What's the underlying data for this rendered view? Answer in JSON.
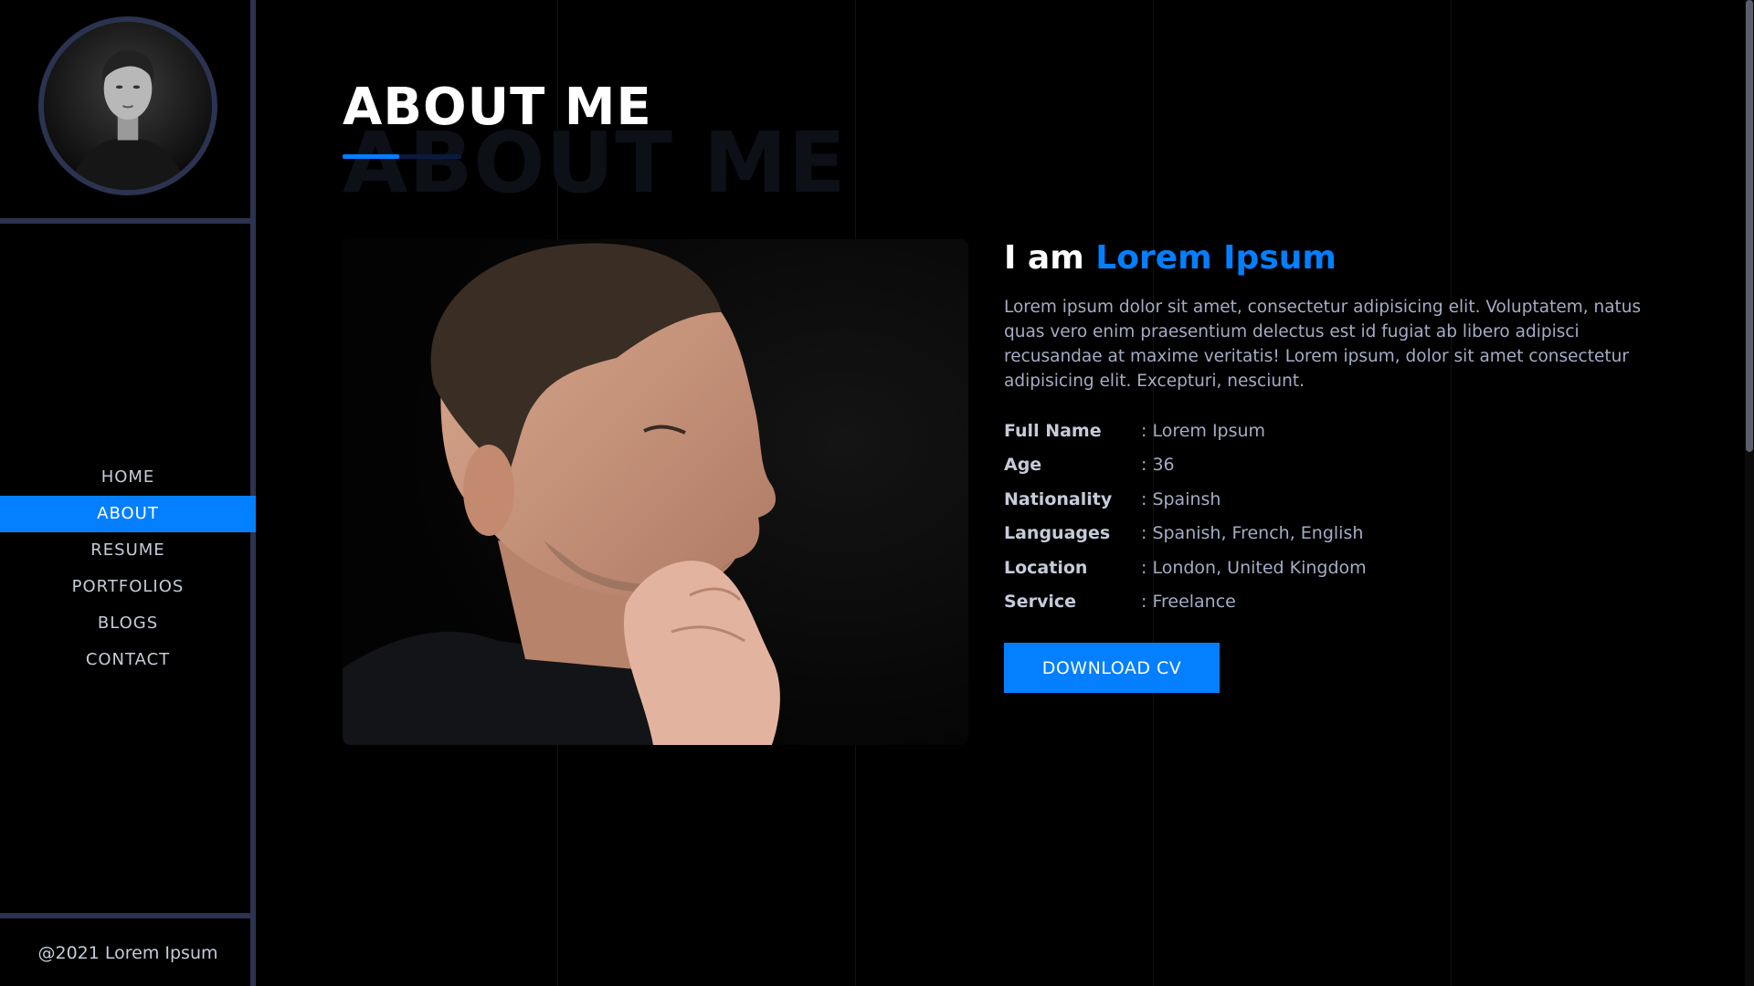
{
  "sidebar": {
    "nav": [
      {
        "label": "HOME",
        "active": false
      },
      {
        "label": "ABOUT",
        "active": true
      },
      {
        "label": "RESUME",
        "active": false
      },
      {
        "label": "PORTFOLIOS",
        "active": false
      },
      {
        "label": "BLOGS",
        "active": false
      },
      {
        "label": "CONTACT",
        "active": false
      }
    ],
    "footer": "@2021 Lorem Ipsum"
  },
  "main": {
    "title": "ABOUT ME",
    "title_shadow": "ABOUT ME",
    "intro_prefix": "I am ",
    "intro_name": "Lorem Ipsum",
    "description": "Lorem ipsum dolor sit amet, consectetur adipisicing elit. Voluptatem, natus quas vero enim praesentium delectus est id fugiat ab libero adipisci recusandae at maxime veritatis! Lorem ipsum, dolor sit amet consectetur adipisicing elit. Excepturi, nesciunt.",
    "details": [
      {
        "label": "Full Name",
        "value": ": Lorem Ipsum"
      },
      {
        "label": "Age",
        "value": ": 36"
      },
      {
        "label": "Nationality",
        "value": ": Spainsh"
      },
      {
        "label": "Languages",
        "value": ": Spanish, French, English"
      },
      {
        "label": "Location",
        "value": ": London, United Kingdom"
      },
      {
        "label": "Service",
        "value": ": Freelance"
      }
    ],
    "download_label": "DOWNLOAD CV"
  },
  "colors": {
    "accent": "#037fff",
    "sidebar_border": "#2c3350",
    "background": "#000000"
  }
}
